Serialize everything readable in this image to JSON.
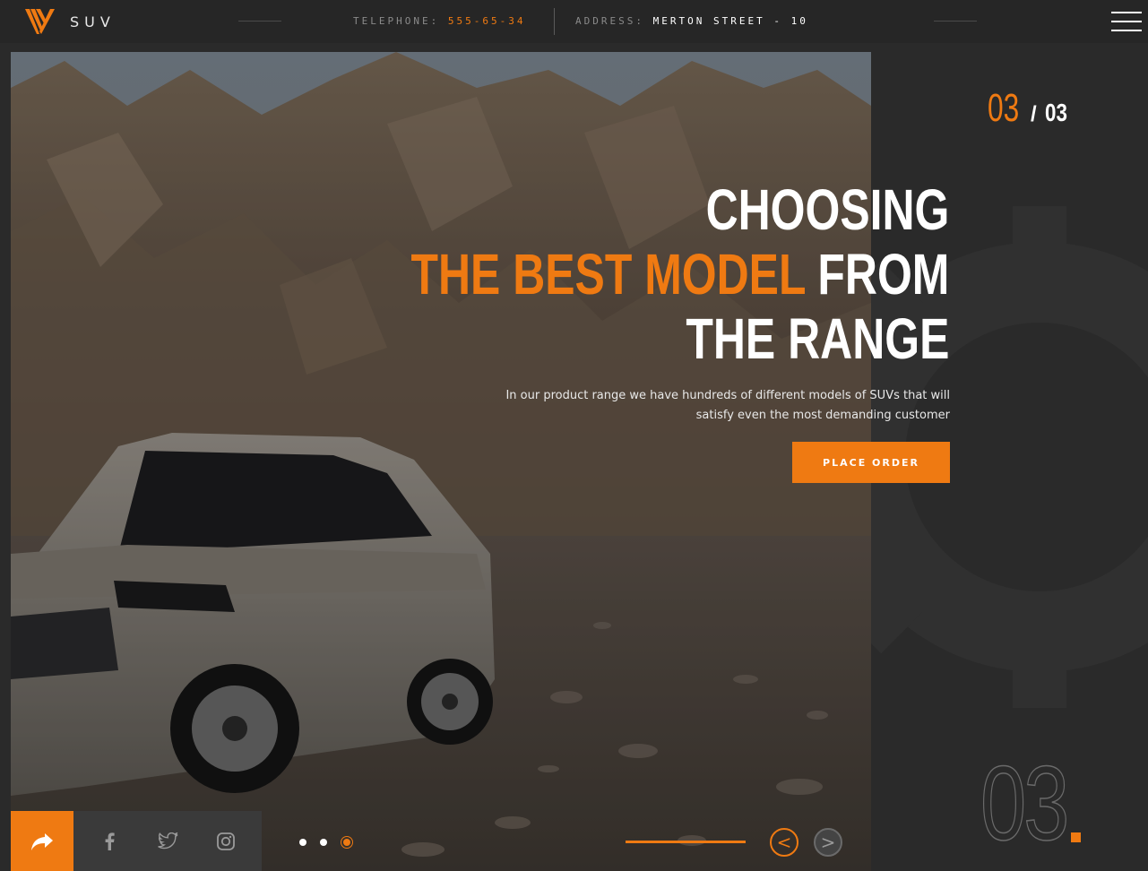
{
  "brand": {
    "name": "SUV",
    "logo_icon": "v-logo-icon"
  },
  "header": {
    "telephone_label": "TELEPHONE:",
    "telephone_value": "555-65-34",
    "address_label": "ADDRESS:",
    "address_value": "MERTON STREET - 10",
    "menu_icon": "hamburger-menu-icon"
  },
  "slider": {
    "current": "03",
    "separator": "/",
    "total": "03",
    "big_number": "03",
    "progress": 1.0,
    "dots": 3,
    "active_dot": 3
  },
  "hero": {
    "line1": "CHOOSING",
    "line2_orange": "THE BEST MODEL",
    "line2_rest": "FROM",
    "line3": "THE RANGE",
    "description": "In our product range we have hundreds of different models of SUVs that will satisfy even the most demanding customer",
    "button_label": "PLACE ORDER"
  },
  "nav": {
    "prev": "<",
    "next": ">"
  },
  "social": [
    "share-icon",
    "facebook-icon",
    "twitter-icon",
    "instagram-icon"
  ],
  "colors": {
    "accent": "#ef7a12",
    "background": "#2a2a2a",
    "header": "#262626"
  }
}
